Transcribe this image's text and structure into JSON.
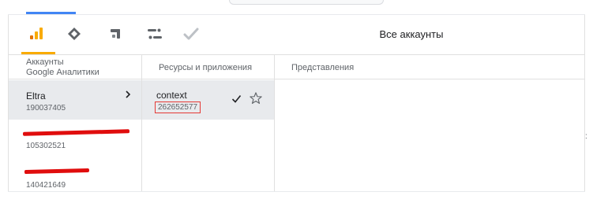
{
  "header": {
    "title": "Все аккаунты",
    "products": [
      {
        "icon": "analytics-icon",
        "active": true,
        "color": "#f9ab00"
      },
      {
        "icon": "optimize-icon",
        "active": false
      },
      {
        "icon": "tag-manager-icon",
        "active": false
      },
      {
        "icon": "data-studio-icon",
        "active": false
      },
      {
        "icon": "surveys-icon",
        "active": false
      }
    ]
  },
  "columns": {
    "accounts_header_line1": "Аккаунты",
    "accounts_header_line2": "Google Аналитики",
    "properties_header": "Ресурсы и приложения",
    "views_header": "Представления"
  },
  "accounts": [
    {
      "name": "Eltra",
      "id": "190037405",
      "selected": true
    },
    {
      "name": "",
      "id": "105302521",
      "redacted": true
    },
    {
      "name": "",
      "id": "140421649",
      "redacted": true
    }
  ],
  "properties": [
    {
      "name": "context",
      "id": "262652577",
      "selected": true
    }
  ],
  "colors": {
    "accent_blue": "#4285f4",
    "analytics_orange": "#f9ab00",
    "highlight_red": "#e53935",
    "selected_bg": "#e8eaed"
  },
  "edge_mark": ":"
}
